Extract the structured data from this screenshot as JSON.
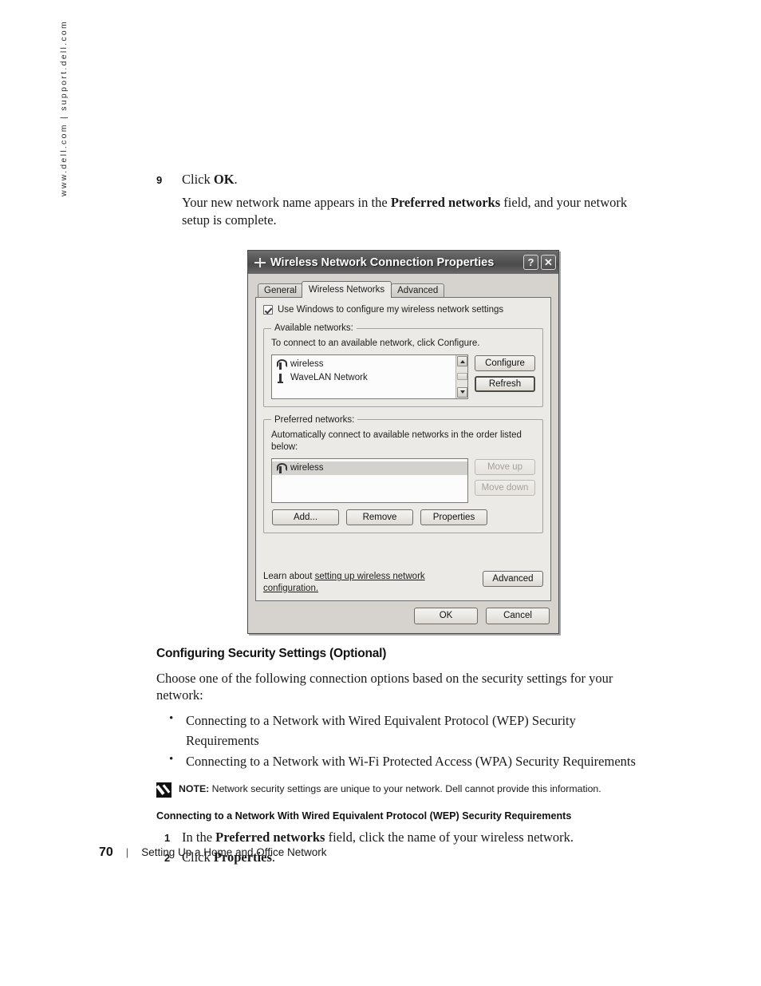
{
  "sidebar": {
    "url_rule": "www.dell.com | support.dell.com"
  },
  "steps_top": {
    "number": "9",
    "text": "Click OK.",
    "click_label": "OK",
    "paragraph_part1": "Your new network name appears in the ",
    "paragraph_bold": "Preferred networks",
    "paragraph_part2": " field, and your network setup is complete."
  },
  "dialog": {
    "title": "Wireless Network Connection Properties",
    "title_icon": "network-connection-icon",
    "help_button": "?",
    "close_button": "✕",
    "tabs": [
      {
        "label": "General",
        "active": false
      },
      {
        "label": "Wireless Networks",
        "active": true
      },
      {
        "label": "Advanced",
        "active": false
      }
    ],
    "use_windows_checkbox": {
      "label": "Use Windows to configure my wireless network settings",
      "checked": true
    },
    "available_networks": {
      "legend": "Available networks:",
      "description": "To connect to an available network, click Configure.",
      "items": [
        {
          "name": "wireless",
          "icon": "access-point-icon"
        },
        {
          "name": "WaveLAN Network",
          "icon": "adhoc-network-icon"
        }
      ],
      "buttons": [
        {
          "label": "Configure",
          "disabled": false,
          "default": false
        },
        {
          "label": "Refresh",
          "disabled": false,
          "default": true
        }
      ]
    },
    "preferred_networks": {
      "legend": "Preferred networks:",
      "description": "Automatically connect to available networks in the order listed below:",
      "items": [
        {
          "name": "wireless",
          "icon": "access-point-icon",
          "selected": true
        }
      ],
      "side_buttons": [
        {
          "label": "Move up",
          "disabled": true
        },
        {
          "label": "Move down",
          "disabled": true
        }
      ],
      "row_buttons": [
        {
          "label": "Add...",
          "disabled": false
        },
        {
          "label": "Remove",
          "disabled": false
        },
        {
          "label": "Properties",
          "disabled": false
        }
      ]
    },
    "learn_more": {
      "prefix": "Learn about ",
      "link": "setting up wireless network configuration.",
      "button": "Advanced"
    },
    "footer_buttons": [
      {
        "label": "OK",
        "default": false
      },
      {
        "label": "Cancel",
        "default": false
      }
    ]
  },
  "section": {
    "heading": "Configuring Security Settings (Optional)",
    "intro": "Choose one of the following connection options based on the security settings for your network:",
    "bullets": [
      "Connecting to a Network with Wired Equivalent Protocol (WEP) Security Requirements",
      "Connecting to a Network with Wi-Fi Protected Access (WPA) Security Requirements"
    ],
    "note": {
      "icon": "note-pencil-icon",
      "label": "NOTE:",
      "text": " Network security settings are unique to your network. Dell cannot provide this information."
    },
    "subheading": "Connecting to a Network With Wired Equivalent Protocol (WEP) Security Requirements",
    "steps": [
      {
        "number": "1",
        "part1": "In the ",
        "bold": "Preferred networks",
        "part2": " field, click the name of your wireless network."
      },
      {
        "number": "2",
        "part1": "Click ",
        "bold": "Properties",
        "part2": "."
      }
    ]
  },
  "footer": {
    "page_number": "70",
    "separator": "|",
    "chapter_title": "Setting Up a Home and Office Network"
  }
}
